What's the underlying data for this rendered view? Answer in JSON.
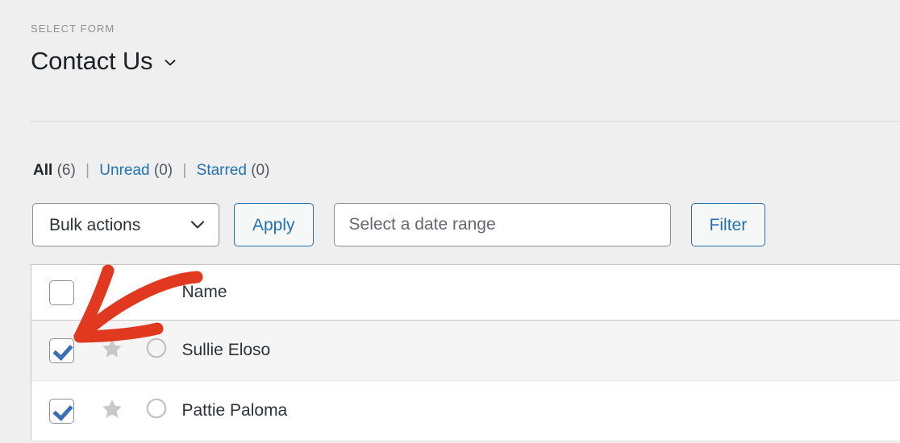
{
  "form_selector": {
    "eyebrow": "SELECT FORM",
    "form_name": "Contact Us",
    "chevron_icon": "chevron-down-icon"
  },
  "status_links": [
    {
      "label": "All",
      "count": "(6)",
      "current": true
    },
    {
      "label": "Unread",
      "count": "(0)",
      "current": false
    },
    {
      "label": "Starred",
      "count": "(0)",
      "current": false
    }
  ],
  "status_separator": "|",
  "toolbar": {
    "bulk_actions_value": "Bulk actions",
    "bulk_actions_chevron": "chevron-down-icon",
    "apply_label": "Apply",
    "date_range_placeholder": "Select a date range",
    "date_range_value": "",
    "filter_label": "Filter"
  },
  "table": {
    "columns": [
      "",
      "",
      "",
      "Name"
    ],
    "header_select_all_checked": false,
    "rows": [
      {
        "checked": true,
        "starred": false,
        "star_icon": "star-icon",
        "read_icon": "unread-circle-icon",
        "name": "Sullie Eloso"
      },
      {
        "checked": true,
        "starred": false,
        "star_icon": "star-icon",
        "read_icon": "unread-circle-icon",
        "name": "Pattie Paloma"
      }
    ]
  },
  "annotation": {
    "type": "curved-arrow",
    "color": "#e0391f",
    "points_to": "row-checkbox"
  },
  "colors": {
    "page_background": "#efeff0",
    "link_blue": "#2271b1",
    "checkmark_blue": "#3c6eb4",
    "annotation_red": "#e0391f",
    "row_alt_background": "#f5f5f5"
  }
}
